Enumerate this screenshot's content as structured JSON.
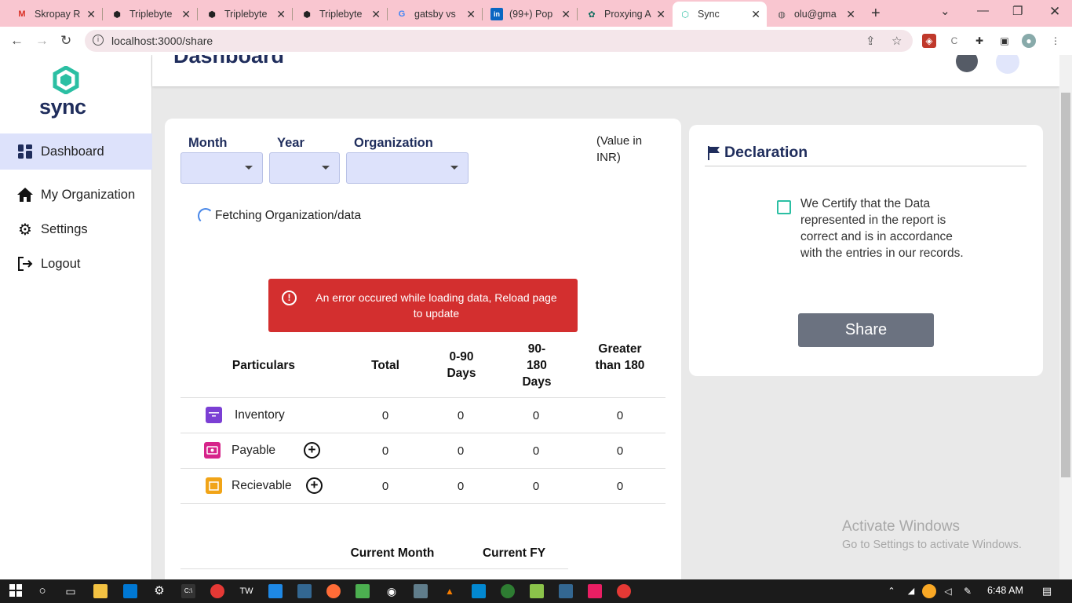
{
  "browser": {
    "tabs": [
      {
        "label": "Skropay R",
        "favicon": "gmail-icon"
      },
      {
        "label": "Triplebyte",
        "favicon": "triplebyte-icon"
      },
      {
        "label": "Triplebyte",
        "favicon": "triplebyte-icon"
      },
      {
        "label": "Triplebyte",
        "favicon": "triplebyte-icon"
      },
      {
        "label": "gatsby vs",
        "favicon": "google-icon"
      },
      {
        "label": "(99+) Pop",
        "favicon": "linkedin-icon"
      },
      {
        "label": "Proxying A",
        "favicon": "react-icon"
      },
      {
        "label": "Sync",
        "favicon": "sync-icon"
      },
      {
        "label": "olu@gma",
        "favicon": "globe-icon"
      }
    ],
    "url": "localhost:3000/share"
  },
  "sidebar": {
    "logo_text": "sync",
    "items": [
      {
        "label": "Dashboard",
        "icon": "dashboard-icon"
      },
      {
        "label": "My Organization",
        "icon": "home-icon"
      },
      {
        "label": "Settings",
        "icon": "gear-icon"
      },
      {
        "label": "Logout",
        "icon": "logout-icon"
      }
    ]
  },
  "header": {
    "title": "Dashboard"
  },
  "filters": {
    "month_label": "Month",
    "year_label": "Year",
    "org_label": "Organization",
    "value_note": "(Value in INR)"
  },
  "status": {
    "fetching": "Fetching Organization/data"
  },
  "error": {
    "message": "An error occured while loading data, Reload page to update"
  },
  "table": {
    "headers": [
      "Particulars",
      "Total",
      "0-90 Days",
      "90-180 Days",
      "Greater than 180"
    ],
    "rows": [
      {
        "name": "Inventory",
        "values": [
          "0",
          "0",
          "0",
          "0"
        ]
      },
      {
        "name": "Payable",
        "values": [
          "0",
          "0",
          "0",
          "0"
        ]
      },
      {
        "name": "Recievable",
        "values": [
          "0",
          "0",
          "0",
          "0"
        ]
      }
    ]
  },
  "second_table": {
    "headers": [
      "Current Month",
      "Current FY"
    ]
  },
  "declaration": {
    "title": "Declaration",
    "text": "We Certify that the Data represented in the report is correct and is in accordance with the entries in our records.",
    "share_label": "Share"
  },
  "watermark": {
    "line1": "Activate Windows",
    "line2": "Go to Settings to activate Windows."
  },
  "taskbar": {
    "time": "6:48 AM"
  },
  "colors": {
    "brand": "#1f2d5c",
    "accent": "#2bbfa3",
    "error": "#d32f2f",
    "nav_active": "#dde2fb"
  }
}
